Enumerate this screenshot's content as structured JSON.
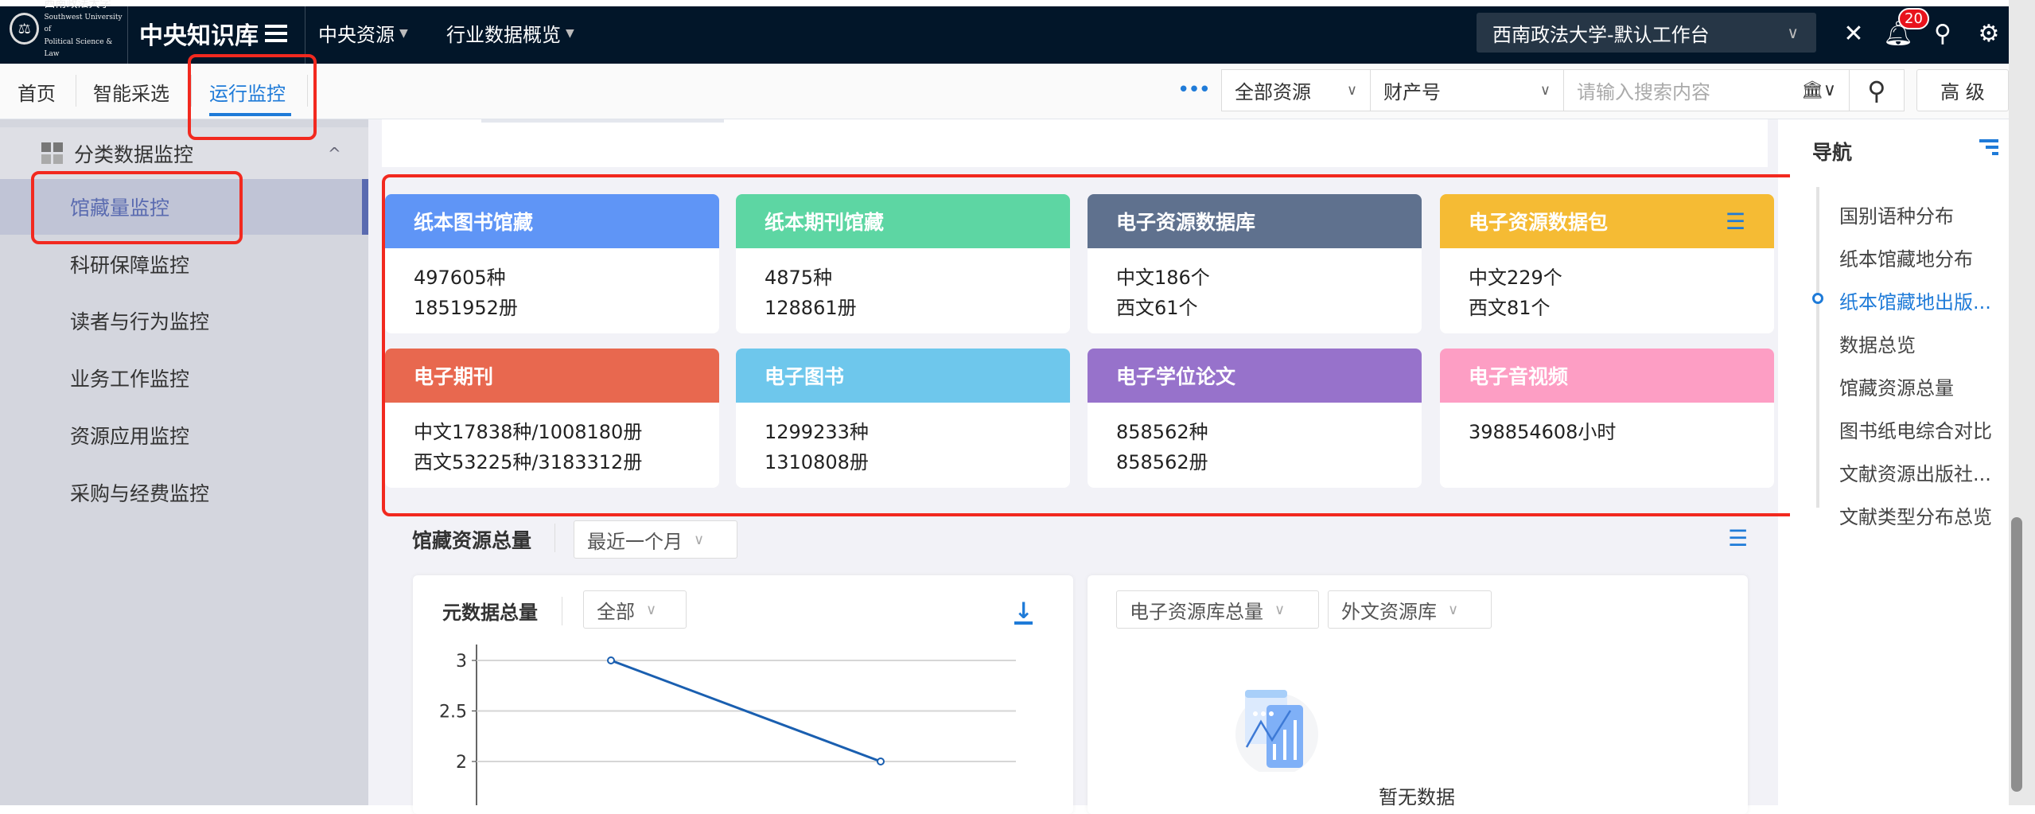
{
  "header": {
    "logo_text": "西南政法大学 Southwest University of Political Science & Law",
    "brand": "中央知识库",
    "menus": [
      "中央资源",
      "行业数据概览"
    ],
    "workspace": "西南政法大学-默认工作台",
    "notification_count": "20"
  },
  "subnav": {
    "tabs": [
      "首页",
      "智能采选",
      "运行监控"
    ],
    "search": {
      "scope": "全部资源",
      "field": "财产号",
      "placeholder": "请输入搜索内容",
      "advanced": "高 级"
    }
  },
  "sidebar": {
    "group": "分类数据监控",
    "items": [
      "馆藏量监控",
      "科研保障监控",
      "读者与行为监控",
      "业务工作监控",
      "资源应用监控",
      "采购与经费监控"
    ]
  },
  "cards": [
    {
      "title": "纸本图书馆藏",
      "color": "#5f95f6",
      "lines": [
        "497605种",
        "1851952册"
      ]
    },
    {
      "title": "纸本期刊馆藏",
      "color": "#5dd6a3",
      "lines": [
        "4875种",
        "128861册"
      ]
    },
    {
      "title": "电子资源数据库",
      "color": "#5f718e",
      "lines": [
        "中文186个",
        "西文61个"
      ]
    },
    {
      "title": "电子资源数据包",
      "color": "#f5bb34",
      "lines": [
        "中文229个",
        "西文81个"
      ]
    },
    {
      "title": "电子期刊",
      "color": "#e8684f",
      "lines": [
        "中文17838种/1008180册",
        "西文53225种/3183312册"
      ]
    },
    {
      "title": "电子图书",
      "color": "#6ec7ec",
      "lines": [
        "1299233种",
        "1310808册"
      ]
    },
    {
      "title": "电子学位论文",
      "color": "#9772cb",
      "lines": [
        "858562种",
        "858562册"
      ]
    },
    {
      "title": "电子音视频",
      "color": "#fd9ec4",
      "lines": [
        "398854608小时",
        ""
      ]
    }
  ],
  "section": {
    "title": "馆藏资源总量",
    "period": "最近一个月",
    "left_panel": {
      "title": "元数据总量",
      "filter": "全部"
    },
    "right_panel": {
      "filter1": "电子资源库总量",
      "filter2": "外文资源库",
      "empty": "暂无数据"
    }
  },
  "chart_data": {
    "type": "line",
    "title": "元数据总量",
    "y_ticks": [
      "3",
      "2.5",
      "2"
    ],
    "ylim": [
      2,
      3
    ],
    "values": [
      3,
      2
    ],
    "line_color": "#1a5fb0",
    "grid": true
  },
  "right_nav": {
    "title": "导航",
    "items": [
      "国别语种分布",
      "纸本馆藏地分布",
      "纸本馆藏地出版...",
      "数据总览",
      "馆藏资源总量",
      "图书纸电综合对比",
      "文献资源出版社...",
      "文献类型分布总览"
    ],
    "active_index": 2
  }
}
